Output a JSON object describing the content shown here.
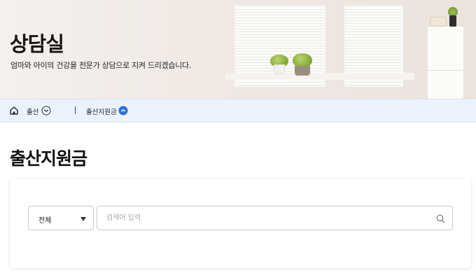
{
  "hero": {
    "title": "상담실",
    "description": "엄마와 아이의 건강을 전문가 상담으로 지켜 드리겠습니다."
  },
  "breadcrumb": {
    "home_icon": "home-icon",
    "items": [
      {
        "label": "출산",
        "icon": "chevron-down-circle-icon"
      },
      {
        "label": "출산지원금",
        "icon": "chevron-up-filled-circle-icon"
      }
    ]
  },
  "page": {
    "title": "출산지원금"
  },
  "search": {
    "category_selected": "전체",
    "placeholder": "검색어 입력",
    "value": "",
    "icon": "search-icon"
  },
  "colors": {
    "breadcrumb_bg": "#ecf2fb",
    "accent_blue": "#2f6fd6"
  }
}
